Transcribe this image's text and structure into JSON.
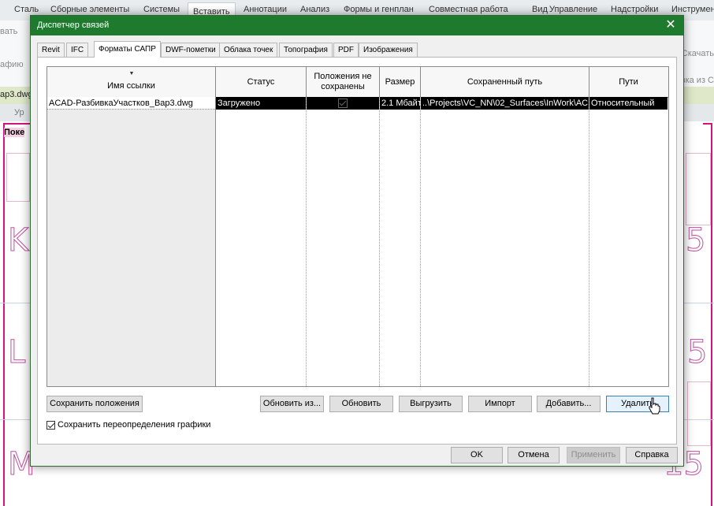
{
  "ribbon": {
    "tabs": [
      "Сталь",
      "Сборные элементы",
      "Системы",
      "Вставить",
      "Аннотации",
      "Анализ",
      "Формы и генплан",
      "Совместная работа",
      "Вид",
      "Управление",
      "Надстройки",
      "Инструмен"
    ],
    "active_tab": "Вставить",
    "left_fragments": [
      "вать",
      "афию"
    ],
    "right_fragments": [
      "Скачать",
      "узка из С"
    ]
  },
  "document": {
    "tab_label": "ap3.dwg",
    "view_fragment": "Ур",
    "view_label_fragment": "Поке"
  },
  "canvas": {
    "letters": [
      "K",
      "5",
      "L",
      "5",
      "M",
      "15"
    ]
  },
  "dialog": {
    "title": "Диспетчер связей",
    "close_glyph": "✕",
    "tabs": [
      "Revit",
      "IFC",
      "Форматы САПР",
      "DWF-пометки",
      "Облака точек",
      "Топография",
      "PDF",
      "Изображения"
    ],
    "active_tab": "Форматы САПР",
    "table": {
      "sort_glyph": "▼",
      "columns": [
        "Имя ссылки",
        "Статус",
        "Положения не сохранены",
        "Размер",
        "Сохраненный путь",
        "Пути"
      ],
      "rows": [
        {
          "name": "ACAD-РазбивкаУчастков_Вар3.dwg",
          "status": "Загружено",
          "positions_unsaved": true,
          "size": "2.1 Мбайт",
          "saved_path": "..\\Projects\\VC_NN\\02_Surfaces\\InWork\\AC",
          "path_type": "Относительный"
        }
      ]
    },
    "buttons": {
      "save_positions": "Сохранить положения",
      "reload_from": "Обновить из...",
      "reload": "Обновить",
      "unload": "Выгрузить",
      "import": "Импорт",
      "add": "Добавить...",
      "remove": "Удалить"
    },
    "checkbox": {
      "label": "Сохранить переопределения графики",
      "checked": true
    },
    "footer": {
      "ok": "OK",
      "cancel": "Отмена",
      "apply": "Применить",
      "help": "Справка"
    }
  },
  "colors": {
    "titlebar": "#1e7b2d",
    "selection": "#000000",
    "frame": "#d4147a"
  }
}
